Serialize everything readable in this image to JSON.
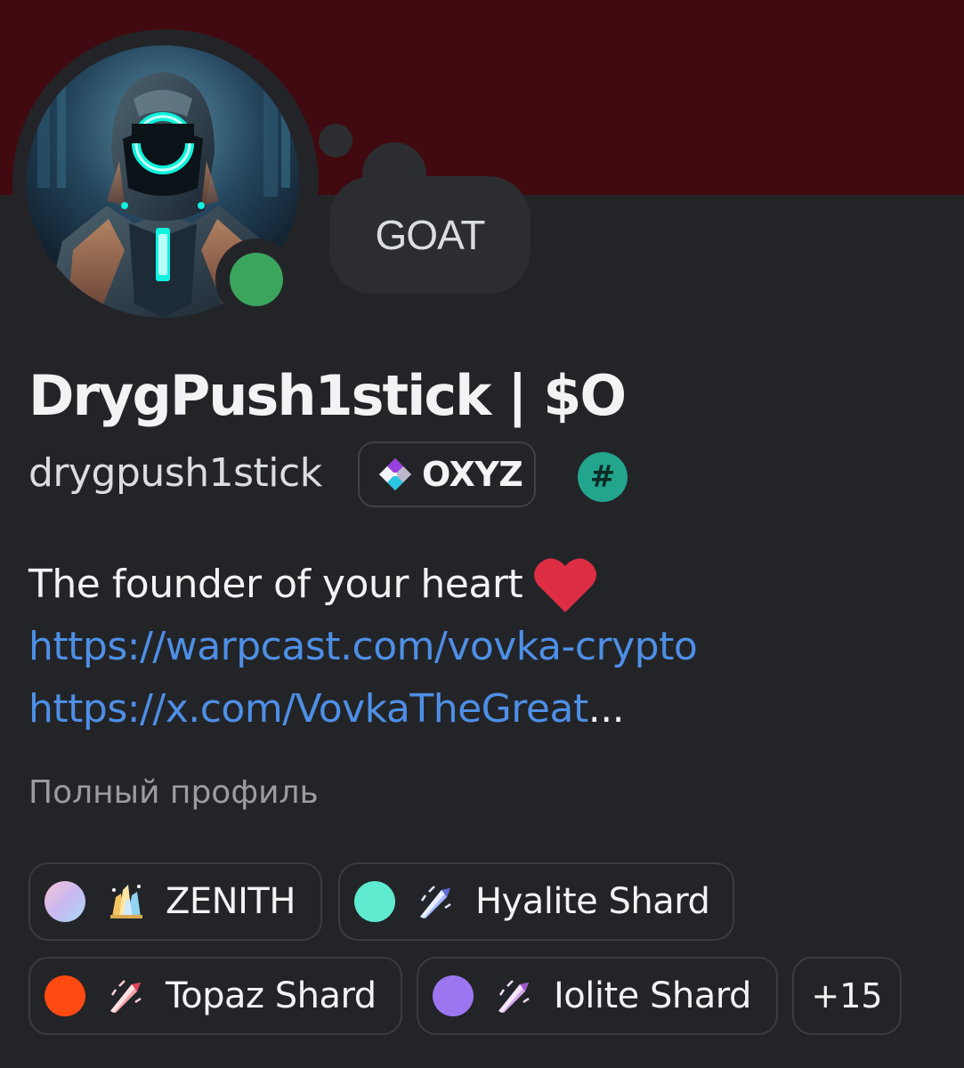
{
  "status_bubble": {
    "text": "GOAT"
  },
  "profile": {
    "display_name": "DrygPush1stick | $O",
    "username": "drygpush1stick",
    "clan_tag": "OXYZ",
    "badge_symbol": "#",
    "status": "online",
    "avatar_icon": "armored-robot-avatar"
  },
  "bio": {
    "line1": "The founder of your heart",
    "heart_icon": "red-heart-emoji",
    "link1": "https://warpcast.com/vovka-crypto",
    "link2": "https://x.com/VovkaTheGreat",
    "link2_ellipsis": "..."
  },
  "full_profile_label": "Полный профиль",
  "roles": [
    {
      "label": "ZENITH",
      "color": "#c9b8f0",
      "icon": "crystal-cluster-icon"
    },
    {
      "label": "Hyalite Shard",
      "color": "#5eebd0",
      "icon": "blue-shard-icon"
    },
    {
      "label": "Topaz Shard",
      "color": "#ff4a12",
      "icon": "red-shard-icon"
    },
    {
      "label": "Iolite Shard",
      "color": "#9b76f0",
      "icon": "lavender-shard-icon"
    }
  ],
  "more_roles_label": "+15",
  "colors": {
    "banner": "#410a10",
    "background": "#232428",
    "link": "#4e8fe6",
    "online": "#3ba55d"
  }
}
